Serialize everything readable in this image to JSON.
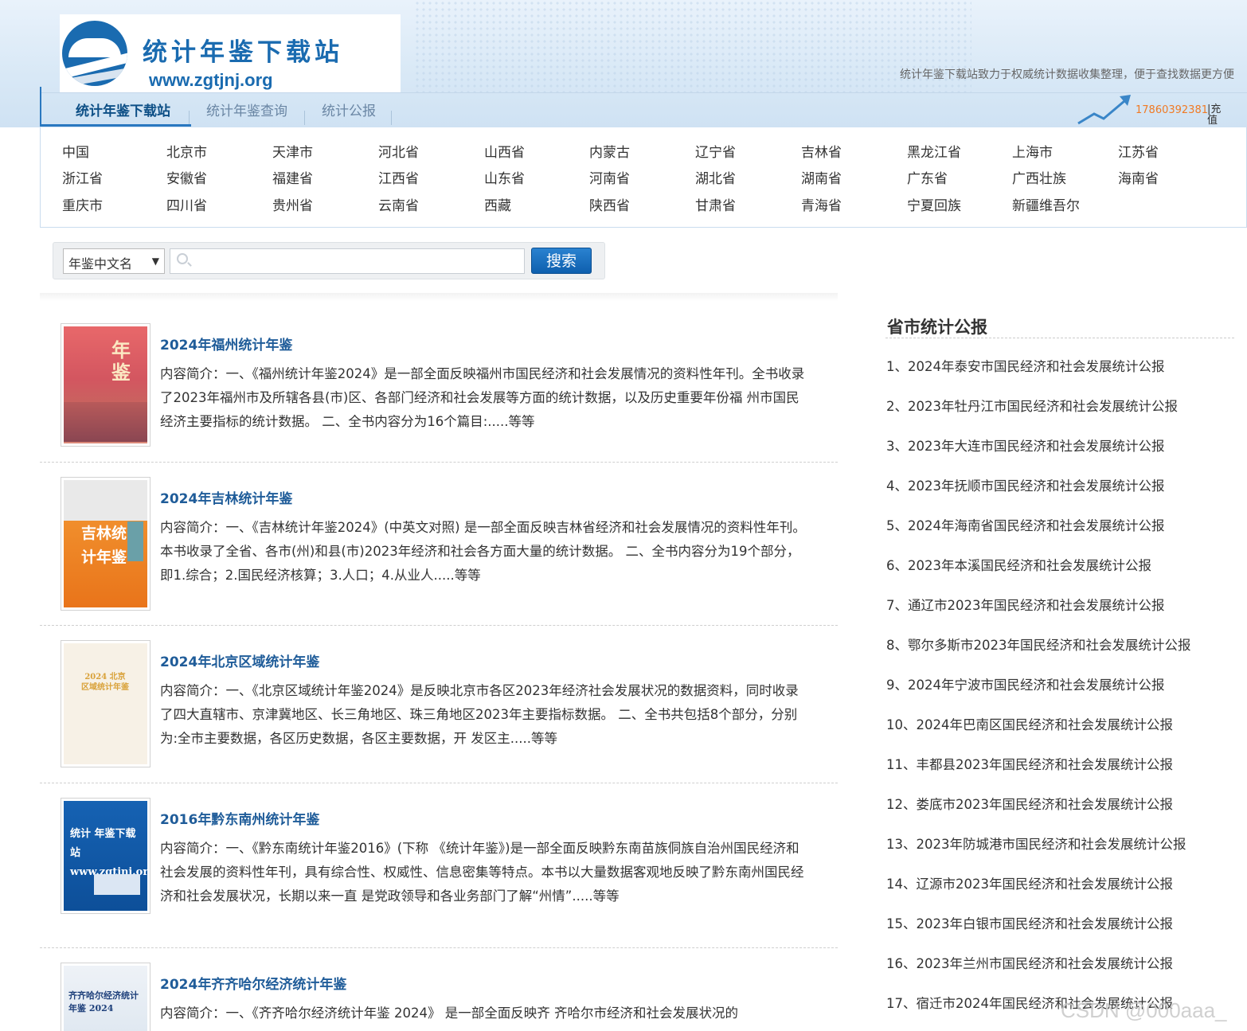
{
  "site": {
    "title": "统计年鉴下载站",
    "url": "www.zgtjnj.org",
    "tagline": "统计年鉴下载站致力于权威统计数据收集整理，便于查找数据更方便",
    "phone": "17860392381",
    "recharge": "|充值"
  },
  "nav": [
    {
      "label": "统计年鉴下载站"
    },
    {
      "label": "统计年鉴查询"
    },
    {
      "label": "统计公报"
    }
  ],
  "regions": [
    "中国",
    "北京市",
    "天津市",
    "河北省",
    "山西省",
    "内蒙古",
    "辽宁省",
    "吉林省",
    "黑龙江省",
    "上海市",
    "江苏省",
    "浙江省",
    "安徽省",
    "福建省",
    "江西省",
    "山东省",
    "河南省",
    "湖北省",
    "湖南省",
    "广东省",
    "广西壮族",
    "海南省",
    "重庆市",
    "四川省",
    "贵州省",
    "云南省",
    "西藏",
    "陕西省",
    "甘肃省",
    "青海省",
    "宁夏回族",
    "新疆维吾尔"
  ],
  "search": {
    "select_value": "年鉴中文名",
    "button": "搜索"
  },
  "books": [
    {
      "title": "2024年福州统计年鉴",
      "desc": "内容简介：一、《福州统计年鉴2024》是一部全面反映福州市国民经济和社会发展情况的资料性年刊。全书收录 了2023年福州市及所辖各县(市)区、各部门经济和社会发展等方面的统计数据，以及历史重要年份福 州市国民经济主要指标的统计数据。 二、全书内容分为16个篇目:.....等等",
      "cover_text": "年鉴"
    },
    {
      "title": "2024年吉林统计年鉴",
      "desc": "内容简介：一、《吉林统计年鉴2024》(中英文对照) 是一部全面反映吉林省经济和社会发展情况的资料性年刊。本书收录了全省、各市(州)和县(市)2023年经济和社会各方面大量的统计数据。 二、全书内容分为19个部分，即1.综合；2.国民经济核算；3.人口；4.从业人.....等等",
      "cover_text": "吉林统计年鉴"
    },
    {
      "title": "2024年北京区域统计年鉴",
      "desc": "内容简介：一、《北京区域统计年鉴2024》是反映北京市各区2023年经济社会发展状况的数据资料，同时收录了四大直辖市、京津冀地区、长三角地区、珠三角地区2023年主要指标数据。 二、全书共包括8个部分，分别为:全市主要数据，各区历史数据，各区主要数据，开 发区主.....等等",
      "cover_text": "2024 北京区域统计年鉴"
    },
    {
      "title": "2016年黔东南州统计年鉴",
      "desc": "内容简介：一、《黔东南统计年鉴2016》(下称 《统计年鉴》)是一部全面反映黔东南苗族侗族自治州国民经济和社会发展的资料性年刊，具有综合性、权威性、信息密集等特点。本书以大量数据客观地反映了黔东南州国民经济和社会发展状况，长期以来一直 是党政领导和各业务部门了解“州情”.....等等",
      "cover_text": "统计 年鉴下载站 www.zgtjnj.org"
    },
    {
      "title": "2024年齐齐哈尔经济统计年鉴",
      "desc": "内容简介：一、《齐齐哈尔经济统计年鉴 2024》 是一部全面反映齐 齐哈尔市经济和社会发展状况的",
      "cover_text": "齐齐哈尔经济统计 年鉴 2024"
    }
  ],
  "sidebar": {
    "title": "省市统计公报",
    "items": [
      "1、2024年泰安市国民经济和社会发展统计公报",
      "2、2023年牡丹江市国民经济和社会发展统计公报",
      "3、2023年大连市国民经济和社会发展统计公报",
      "4、2023年抚顺市国民经济和社会发展统计公报",
      "5、2024年海南省国民经济和社会发展统计公报",
      "6、2023年本溪国民经济和社会发展统计公报",
      "7、通辽市2023年国民经济和社会发展统计公报",
      "8、鄂尔多斯市2023年国民经济和社会发展统计公报",
      "9、2024年宁波市国民经济和社会发展统计公报",
      "10、2024年巴南区国民经济和社会发展统计公报",
      "11、丰都县2023年国民经济和社会发展统计公报",
      "12、娄底市2023年国民经济和社会发展统计公报",
      "13、2023年防城港市国民经济和社会发展统计公报",
      "14、辽源市2023年国民经济和社会发展统计公报",
      "15、2023年白银市国民经济和社会发展统计公报",
      "16、2023年兰州市国民经济和社会发展统计公报",
      "17、宿迁市2024年国民经济和社会发展统计公报"
    ]
  },
  "watermark": "CSDN @000aaa_"
}
